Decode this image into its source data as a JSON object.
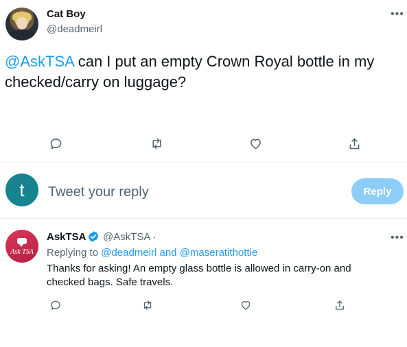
{
  "main_tweet": {
    "display_name": "Cat Boy",
    "handle": "@deadmeirl",
    "more_label": "•••",
    "mention": "@AskTSA",
    "text": " can I put an empty Crown Royal bottle in my checked/carry on luggage?",
    "actions": [
      "reply-icon",
      "retweet-icon",
      "like-icon",
      "share-icon"
    ]
  },
  "composer": {
    "avatar_letter": "t",
    "placeholder": "Tweet your reply",
    "button_label": "Reply",
    "button_color": "#8ecdf8",
    "avatar_color": "#17838f"
  },
  "reply_tweet": {
    "display_name": "AskTSA",
    "handle_sep": "@AskTSA ·",
    "avatar_text": "Ask TSA",
    "more_label": "•••",
    "replying_prefix": "Replying to ",
    "replying_user1": "@deadmeirl",
    "replying_and": " and ",
    "replying_user2": "@maseratithottie",
    "text": "Thanks for asking! An empty glass bottle is allowed in carry-on and checked bags. Safe travels."
  },
  "colors": {
    "accent": "#1d9bf0",
    "secondary_text": "#536471",
    "primary_text": "#0f1419"
  }
}
